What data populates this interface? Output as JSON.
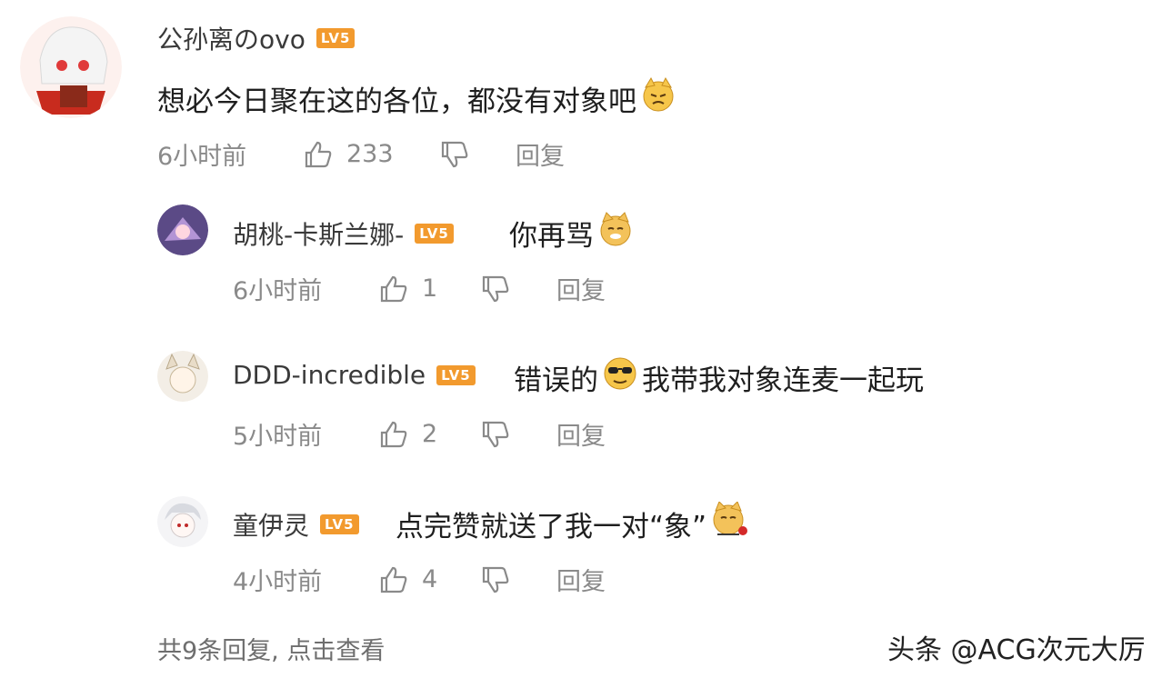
{
  "comment": {
    "user": "公孙离のovo",
    "level": "LV5",
    "text": "想必今日聚在这的各位，都没有对象吧",
    "time": "6小时前",
    "likes": "233",
    "reply_label": "回复"
  },
  "replies": [
    {
      "user": "胡桃-卡斯兰娜-",
      "level": "LV5",
      "text": "你再骂",
      "time": "6小时前",
      "likes": "1",
      "reply_label": "回复"
    },
    {
      "user": "DDD-incredible",
      "level": "LV5",
      "text_before": "错误的",
      "text_after": "我带我对象连麦一起玩",
      "time": "5小时前",
      "likes": "2",
      "reply_label": "回复"
    },
    {
      "user": "童伊灵",
      "level": "LV5",
      "text": "点完赞就送了我一对“象”",
      "time": "4小时前",
      "likes": "4",
      "reply_label": "回复"
    }
  ],
  "footer": {
    "more_replies": "共9条回复, 点击查看"
  },
  "watermark": "头条 @ACG次元大厉",
  "colors": {
    "level_badge": "#f29a2e",
    "meta_text": "#8a8a8a"
  }
}
